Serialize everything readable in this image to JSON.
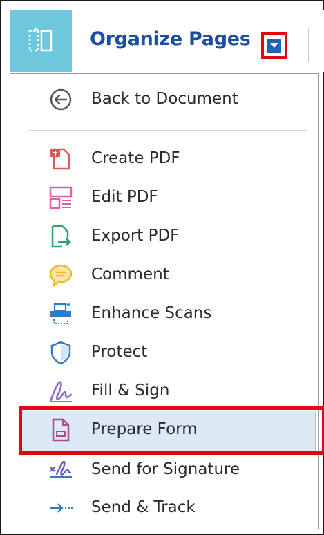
{
  "toolbar": {
    "title": "Organize Pages",
    "accent_color": "#6fc7de",
    "tool_icon": "organize-pages-icon",
    "dropdown_icon": "triangle-down-icon"
  },
  "menu": {
    "back": {
      "label": "Back to Document",
      "icon": "back-arrow-circle-icon"
    },
    "items": [
      {
        "label": "Create PDF",
        "icon": "create-pdf-icon"
      },
      {
        "label": "Edit PDF",
        "icon": "edit-pdf-icon"
      },
      {
        "label": "Export PDF",
        "icon": "export-pdf-icon"
      },
      {
        "label": "Comment",
        "icon": "comment-icon"
      },
      {
        "label": "Enhance Scans",
        "icon": "enhance-scans-icon"
      },
      {
        "label": "Protect",
        "icon": "protect-shield-icon"
      },
      {
        "label": "Fill & Sign",
        "icon": "fill-sign-icon"
      },
      {
        "label": "Prepare Form",
        "icon": "prepare-form-icon",
        "selected": true
      },
      {
        "label": "Send for Signature",
        "icon": "send-signature-icon"
      },
      {
        "label": "Send & Track",
        "icon": "send-track-icon"
      }
    ]
  }
}
